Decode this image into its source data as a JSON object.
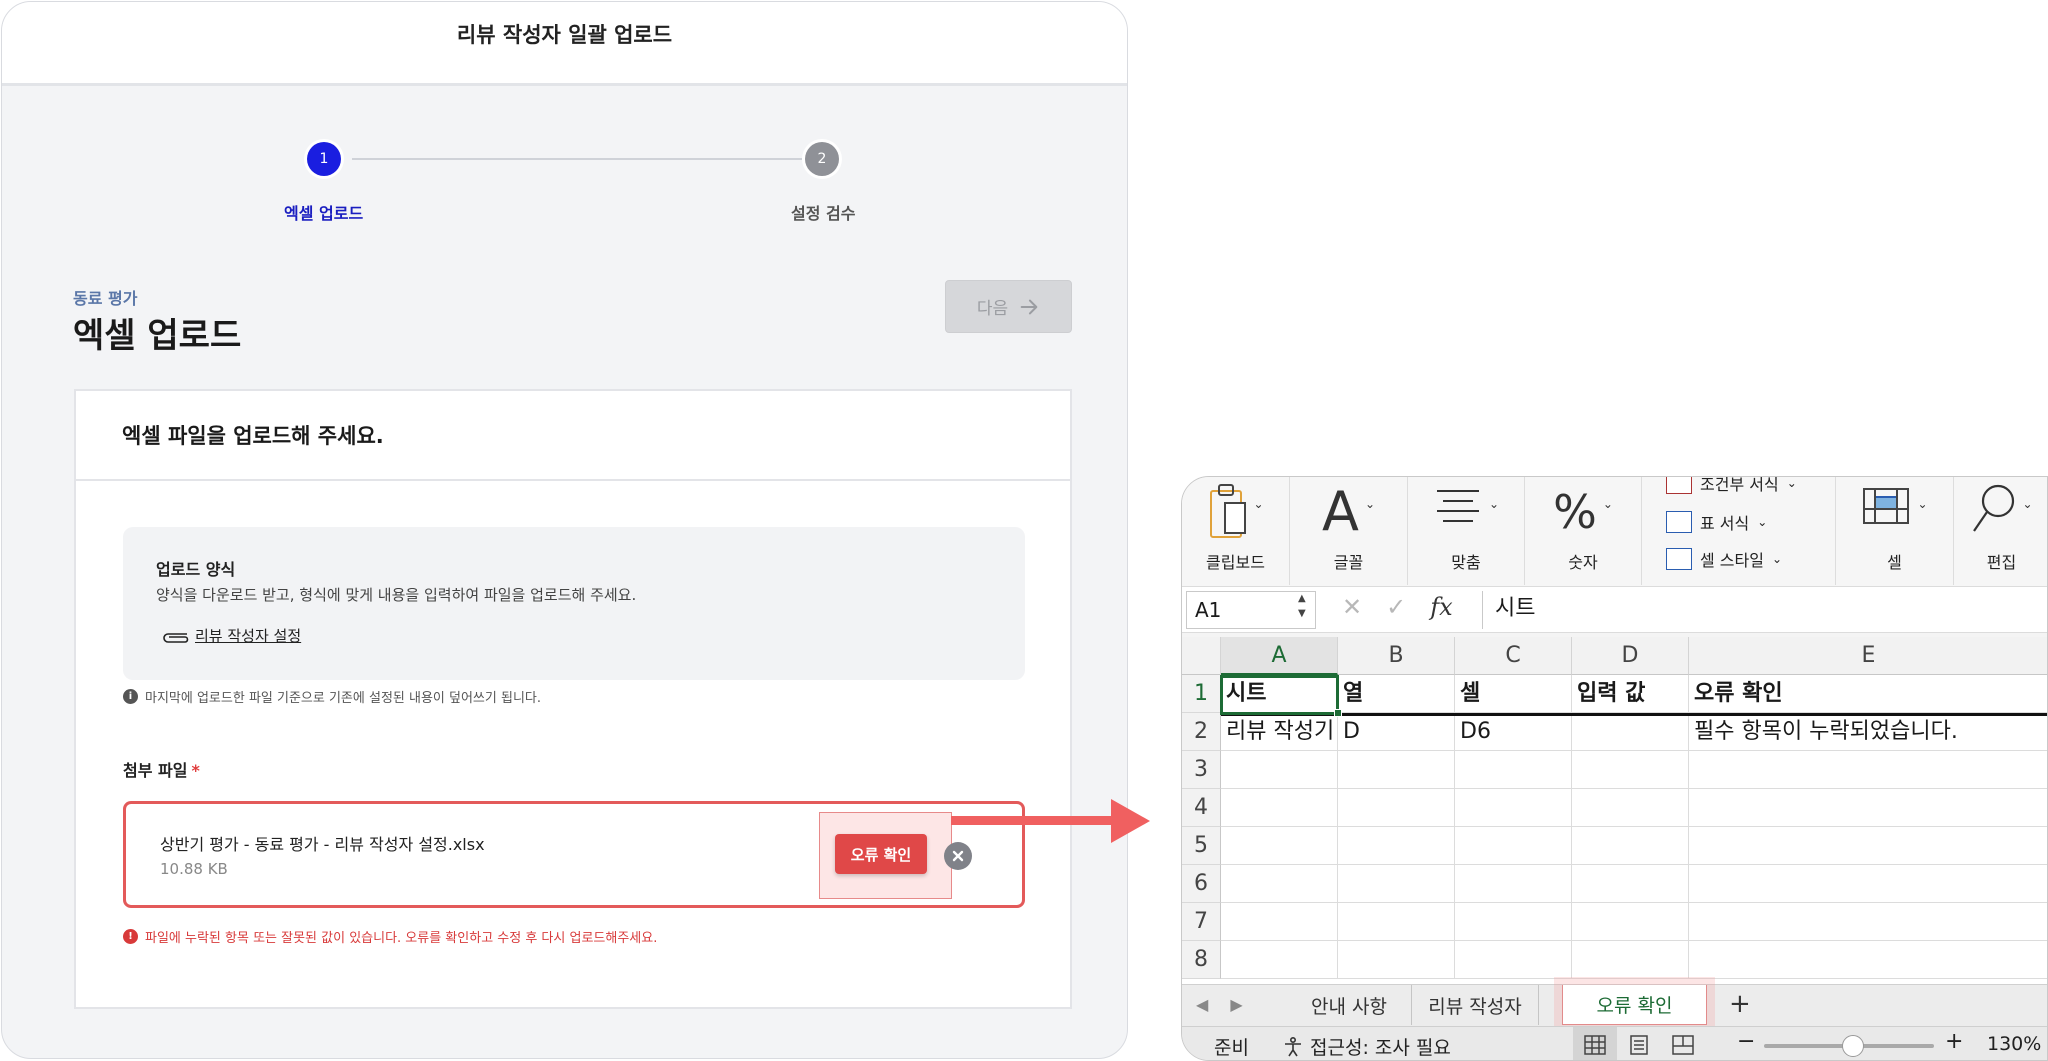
{
  "modal": {
    "title": "리뷰 작성자 일괄 업로드",
    "steps": [
      {
        "number": "1",
        "label": "엑셀 업로드"
      },
      {
        "number": "2",
        "label": "설정 검수"
      }
    ],
    "breadcrumb": "동료 평가",
    "page_title": "엑셀 업로드",
    "next_label": "다음",
    "card_title": "엑셀 파일을 업로드해 주세요.",
    "guide": {
      "title": "업로드 양식",
      "description": "양식을 다운로드 받고, 형식에 맞게 내용을 입력하여 파일을 업로드해 주세요.",
      "link_label": "리뷰 작성자 설정"
    },
    "notice": "마지막에 업로드한 파일 기준으로 기존에 설정된 내용이 덮어쓰기 됩니다.",
    "attach_label": "첨부 파일",
    "required_mark": "*",
    "file": {
      "name": "상반기 평가 - 동료 평가 - 리뷰 작성자 설정.xlsx",
      "size": "10.88 KB",
      "error_button": "오류 확인"
    },
    "error_message": "파일에 누락된 항목 또는 잘못된 값이 있습니다. 오류를 확인하고 수정 후 다시 업로드해주세요.",
    "colors": {
      "primary": "#1a1ee0",
      "error": "#e04848",
      "highlight": "#f48c8c"
    }
  },
  "excel": {
    "ribbon": {
      "clipboard": "클립보드",
      "font": "글꼴",
      "align": "맞춤",
      "number": "숫자",
      "styles": [
        "조건부 서식",
        "표 서식",
        "셀 스타일"
      ],
      "cells": "셀",
      "edit": "편집"
    },
    "name_box": "A1",
    "formula_value": "시트",
    "columns": [
      "A",
      "B",
      "C",
      "D",
      "E"
    ],
    "rows": [
      "1",
      "2",
      "3",
      "4",
      "5",
      "6",
      "7",
      "8"
    ],
    "header_row": [
      "시트",
      "열",
      "셀",
      "입력 값",
      "오류 확인"
    ],
    "data_row": [
      "리뷰 작성기",
      "D",
      "D6",
      "",
      "필수 항목이 누락되었습니다."
    ],
    "tabs": [
      "안내 사항",
      "리뷰 작성자",
      "오류 확인"
    ],
    "add_tab": "+",
    "status": {
      "ready": "준비",
      "accessibility": "접근성: 조사 필요",
      "zoom": "130%",
      "zoom_minus": "−",
      "zoom_plus": "+"
    }
  }
}
